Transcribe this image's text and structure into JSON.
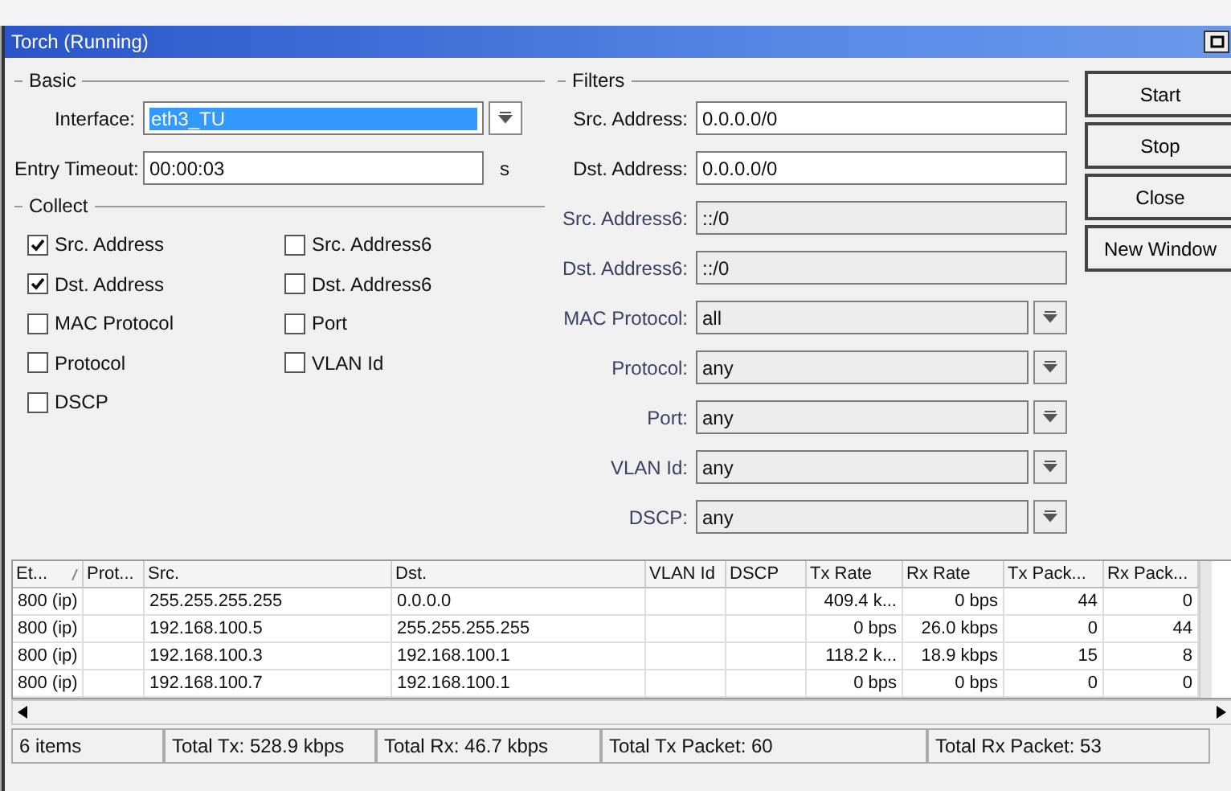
{
  "window": {
    "title": "Torch (Running)"
  },
  "basic": {
    "title": "Basic",
    "interface": {
      "label": "Interface:",
      "value": "eth3_TU",
      "selected": true
    },
    "entry_timeout": {
      "label": "Entry Timeout:",
      "value": "00:00:03",
      "unit": "s"
    }
  },
  "collect": {
    "title": "Collect",
    "items": [
      {
        "label": "Src. Address",
        "checked": true
      },
      {
        "label": "Dst. Address",
        "checked": true
      },
      {
        "label": "MAC Protocol",
        "checked": false
      },
      {
        "label": "Protocol",
        "checked": false
      },
      {
        "label": "DSCP",
        "checked": false
      },
      {
        "label": "Src. Address6",
        "checked": false
      },
      {
        "label": "Dst. Address6",
        "checked": false
      },
      {
        "label": "Port",
        "checked": false
      },
      {
        "label": "VLAN Id",
        "checked": false
      }
    ]
  },
  "filters": {
    "title": "Filters",
    "items": [
      {
        "label": "Src. Address:",
        "value": "0.0.0.0/0",
        "kind": "text",
        "disabled": false
      },
      {
        "label": "Dst. Address:",
        "value": "0.0.0.0/0",
        "kind": "text",
        "disabled": false
      },
      {
        "label": "Src. Address6:",
        "value": "::/0",
        "kind": "text",
        "disabled": true
      },
      {
        "label": "Dst. Address6:",
        "value": "::/0",
        "kind": "text",
        "disabled": true
      },
      {
        "label": "MAC Protocol:",
        "value": "all",
        "kind": "dropdown",
        "disabled": true
      },
      {
        "label": "Protocol:",
        "value": "any",
        "kind": "dropdown",
        "disabled": true
      },
      {
        "label": "Port:",
        "value": "any",
        "kind": "dropdown",
        "disabled": true
      },
      {
        "label": "VLAN Id:",
        "value": "any",
        "kind": "dropdown",
        "disabled": true
      },
      {
        "label": "DSCP:",
        "value": "any",
        "kind": "dropdown",
        "disabled": true
      }
    ]
  },
  "buttons": [
    "Start",
    "Stop",
    "Close",
    "New Window"
  ],
  "table": {
    "columns": [
      {
        "label": "Et...",
        "kind": "text",
        "sorted": true
      },
      {
        "label": "Prot...",
        "kind": "text",
        "sorted": false
      },
      {
        "label": "Src.",
        "kind": "text",
        "sorted": false
      },
      {
        "label": "Dst.",
        "kind": "text",
        "sorted": false
      },
      {
        "label": "VLAN Id",
        "kind": "text",
        "sorted": false
      },
      {
        "label": "DSCP",
        "kind": "text",
        "sorted": false
      },
      {
        "label": "Tx Rate",
        "kind": "number",
        "sorted": false
      },
      {
        "label": "Rx Rate",
        "kind": "number",
        "sorted": false
      },
      {
        "label": "Tx Pack...",
        "kind": "number",
        "sorted": false
      },
      {
        "label": "Rx Pack...",
        "kind": "number",
        "sorted": false
      }
    ],
    "rows": [
      [
        "800 (ip)",
        "",
        "255.255.255.255",
        "0.0.0.0",
        "",
        "",
        "409.4 k...",
        "0 bps",
        "44",
        "0"
      ],
      [
        "800 (ip)",
        "",
        "192.168.100.5",
        "255.255.255.255",
        "",
        "",
        "0 bps",
        "26.0 kbps",
        "0",
        "44"
      ],
      [
        "800 (ip)",
        "",
        "192.168.100.3",
        "192.168.100.1",
        "",
        "",
        "118.2 k...",
        "18.9 kbps",
        "15",
        "8"
      ],
      [
        "800 (ip)",
        "",
        "192.168.100.7",
        "192.168.100.1",
        "",
        "",
        "0 bps",
        "0 bps",
        "0",
        "0"
      ]
    ]
  },
  "status_bar": [
    "6 items",
    "Total Tx: 528.9 kbps",
    "Total Rx: 46.7 kbps",
    "Total Tx Packet: 60",
    "Total Rx Packet: 53"
  ]
}
